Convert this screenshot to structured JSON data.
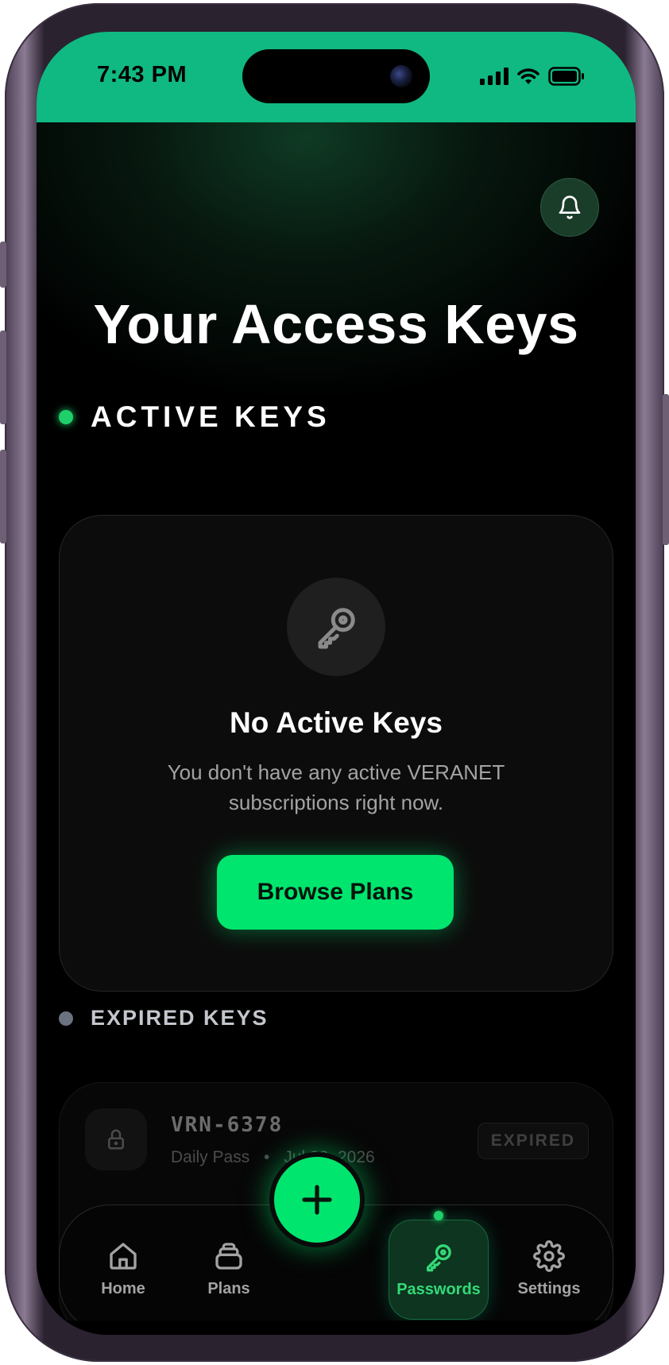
{
  "status_bar": {
    "time": "7:43 PM"
  },
  "page": {
    "title": "Your Access Keys"
  },
  "active_section": {
    "heading": "ACTIVE KEYS",
    "empty_title": "No Active Keys",
    "empty_description": "You don't have any active VERANET subscriptions right now.",
    "browse_button": "Browse Plans"
  },
  "expired_section": {
    "heading": "EXPIRED KEYS",
    "items": [
      {
        "code": "VRN-6378",
        "plan": "Daily Pass",
        "separator": "•",
        "date": "Jul 23, 2026",
        "status": "EXPIRED"
      }
    ]
  },
  "nav": {
    "home": "Home",
    "plans": "Plans",
    "passwords": "Passwords",
    "settings": "Settings",
    "active": "passwords"
  },
  "colors": {
    "status_bar": "#10b981",
    "accent": "#00e56e",
    "active_dot": "#1fcf6a",
    "nav_active_text": "#34d977"
  },
  "icons": {
    "bell": "bell-icon",
    "key": "key-icon",
    "lock": "lock-icon",
    "home": "home-icon",
    "plans": "stack-icon",
    "plus": "plus-icon",
    "settings": "gear-icon"
  }
}
